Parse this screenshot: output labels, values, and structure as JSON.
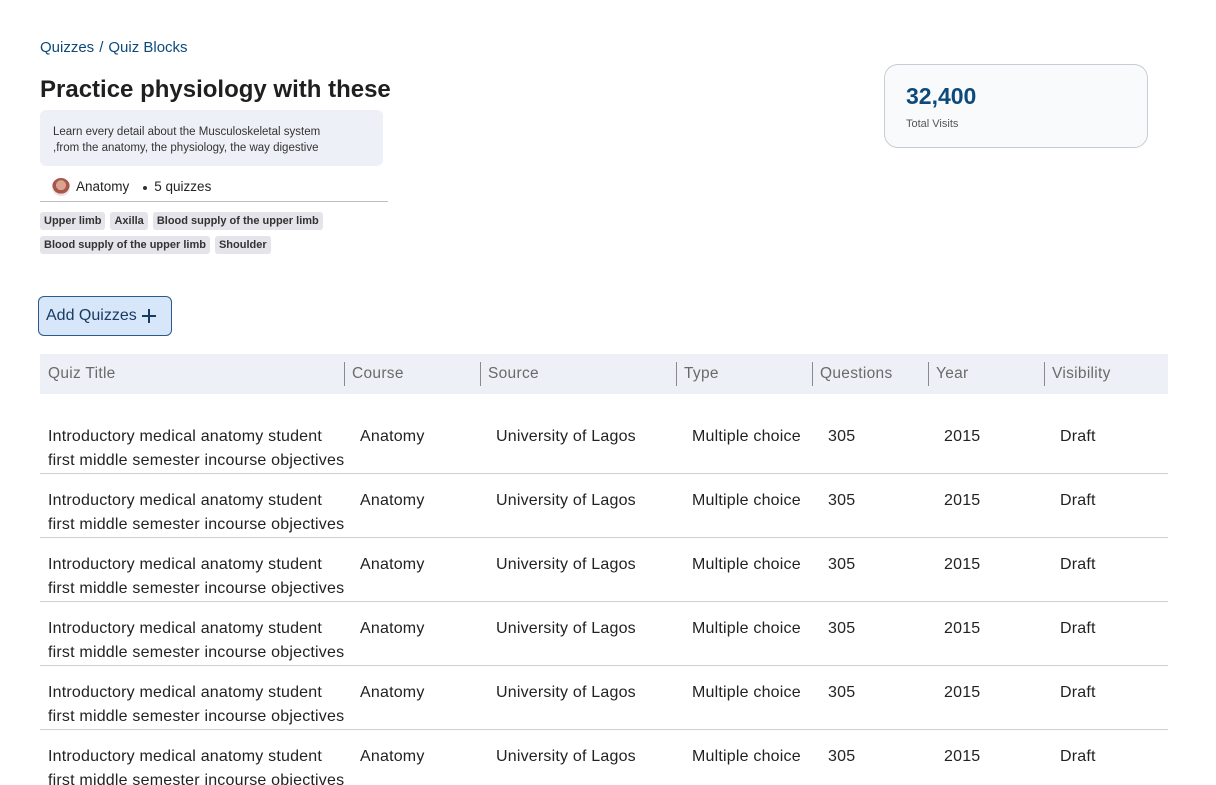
{
  "breadcrumb": {
    "parent": "Quizzes",
    "separator": "/",
    "current": "Quiz Blocks"
  },
  "block": {
    "title": "Practice physiology with these",
    "description_line1": "Learn every detail about the Musculoskeletal system",
    "description_line2": ",from the anatomy, the physiology, the way digestive",
    "course": "Anatomy",
    "quiz_count": "5 quizzes",
    "tags": [
      "Upper limb",
      "Axilla",
      "Blood supply of the upper limb",
      "Blood supply of the upper limb",
      "Shoulder"
    ]
  },
  "stats": {
    "value": "32,400",
    "label": "Total Visits"
  },
  "actions": {
    "add_label": "Add Quizzes",
    "add_icon": "plus-icon"
  },
  "table": {
    "headers": [
      "Quiz Title",
      "Course",
      "Source",
      "Type",
      "Questions",
      "Year",
      "Visibility"
    ],
    "rows": [
      {
        "title1": "Introductory medical anatomy student",
        "title2": "first middle semester incourse objectives",
        "course": "Anatomy",
        "source": "University of Lagos",
        "type": "Multiple choice",
        "questions": "305",
        "year": "2015",
        "visibility": "Draft"
      },
      {
        "title1": "Introductory medical anatomy student",
        "title2": "first middle semester incourse objectives",
        "course": "Anatomy",
        "source": "University of Lagos",
        "type": "Multiple choice",
        "questions": "305",
        "year": "2015",
        "visibility": "Draft"
      },
      {
        "title1": "Introductory medical anatomy student",
        "title2": "first middle semester incourse objectives",
        "course": "Anatomy",
        "source": "University of Lagos",
        "type": "Multiple choice",
        "questions": "305",
        "year": "2015",
        "visibility": "Draft"
      },
      {
        "title1": "Introductory medical anatomy student",
        "title2": "first middle semester incourse objectives",
        "course": "Anatomy",
        "source": "University of Lagos",
        "type": "Multiple choice",
        "questions": "305",
        "year": "2015",
        "visibility": "Draft"
      },
      {
        "title1": "Introductory medical anatomy student",
        "title2": "first middle semester incourse objectives",
        "course": "Anatomy",
        "source": "University of Lagos",
        "type": "Multiple choice",
        "questions": "305",
        "year": "2015",
        "visibility": "Draft"
      },
      {
        "title1": "Introductory medical anatomy student",
        "title2": "first middle semester incourse objectives",
        "course": "Anatomy",
        "source": "University of Lagos",
        "type": "Multiple choice",
        "questions": "305",
        "year": "2015",
        "visibility": "Draft"
      }
    ]
  },
  "colors": {
    "accent": "#0d4a7a",
    "button_bg": "#d8e6f9",
    "header_bg": "#eef0f7"
  }
}
